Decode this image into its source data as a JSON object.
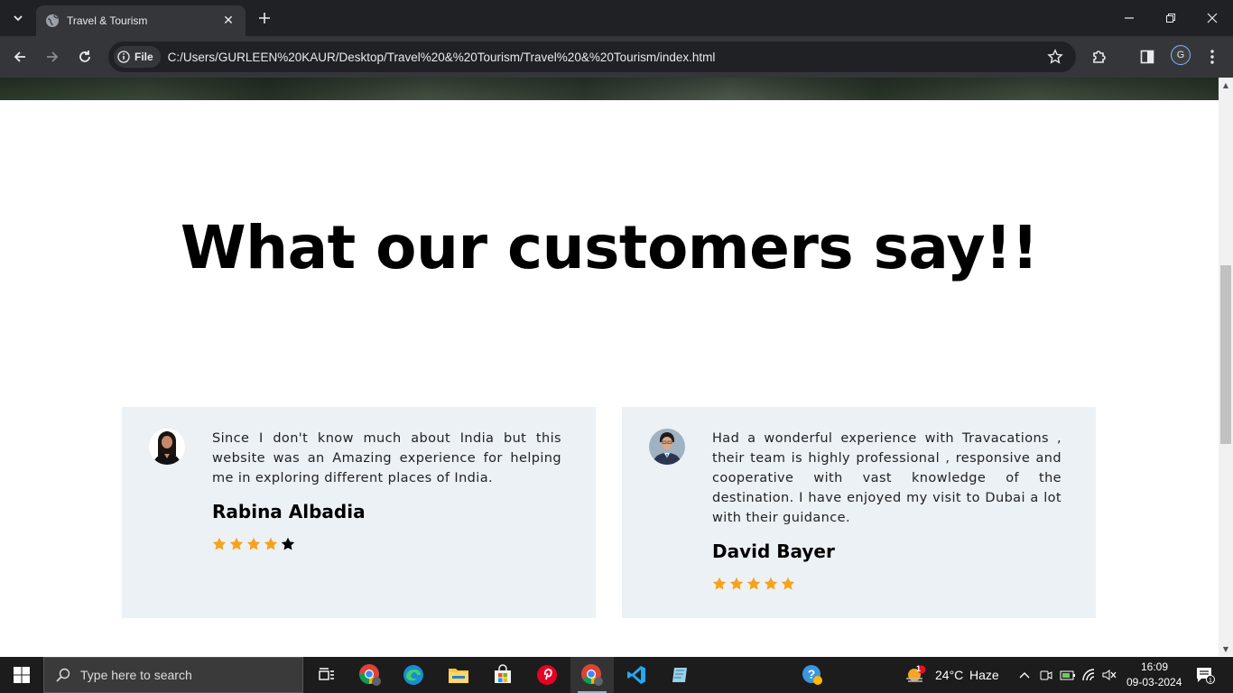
{
  "browser": {
    "tab_title": "Travel & Tourism",
    "chip_label": "File",
    "url": "C:/Users/GURLEEN%20KAUR/Desktop/Travel%20&%20Tourism/Travel%20&%20Tourism/index.html",
    "profile_initial": "G"
  },
  "page": {
    "section_title": "What our customers say!!",
    "testimonials": [
      {
        "quote": "Since I don't know much about India but this website was an Amazing experience for helping me in exploring different places of India.",
        "name": "Rabina Albadia",
        "rating": 4,
        "rating_max": 5
      },
      {
        "quote": "Had a wonderful experience with Travacations , their team is highly professional , responsive and cooperative with vast knowledge of the destination. I have enjoyed my visit to Dubai a lot with their guidance.",
        "name": "David Bayer",
        "rating": 5,
        "rating_max": 5
      }
    ],
    "colors": {
      "star_filled": "#f7a21b",
      "star_empty": "#000000",
      "card_bg": "#ecf1f6"
    }
  },
  "taskbar": {
    "search_placeholder": "Type here to search",
    "weather_temp": "24°C",
    "weather_desc": "Haze",
    "time": "16:09",
    "date": "09-03-2024",
    "weather_badge": "1",
    "notification_count": "1"
  }
}
